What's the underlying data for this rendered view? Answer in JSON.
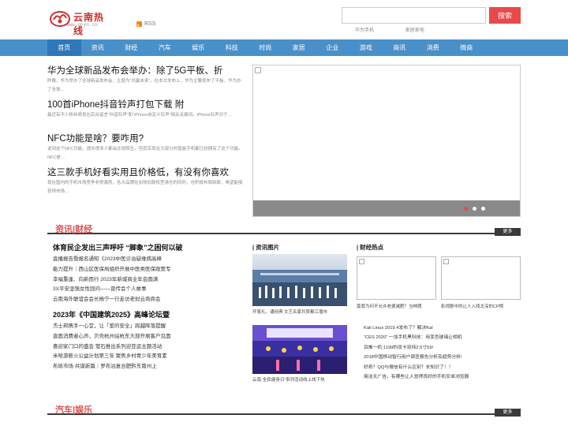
{
  "header": {
    "logo_name": "云南热线",
    "logo_url": "www.onyn.cn",
    "rss_label": "RSS",
    "search_placeholder": "",
    "search_button": "搜索",
    "hot_words": [
      "华为手机",
      "家居家电"
    ]
  },
  "nav": {
    "items": [
      "首页",
      "资讯",
      "财经",
      "汽车",
      "娱乐",
      "科技",
      "时尚",
      "家居",
      "企业",
      "游戏",
      "商讯",
      "消费",
      "微商"
    ],
    "active_index": 0
  },
  "headlines": [
    {
      "title": "华为全球新品发布会举办：除了5G平板、折",
      "desc": "昨晚，华为举办了全球新品发布会，主题为“共赢未来”。在本次发布上，华为主要发布了平板，华为办了全球…"
    },
    {
      "title": "100首iPhone抖音铃声打包下载 附",
      "desc": "最近有不少粉丝频发在后台留言“抖音铃声”和“iPhone自定义铃声”相关关键词。iPhone铃声对于…"
    },
    {
      "title": "NFC功能是啥？要咋用?",
      "desc": "说到这个NFC功能，提许很多人都会比较陌生，但其实现在大部分的智能手机都已经拥有了这个功能。NFC是…"
    },
    {
      "title": "这三款手机好看实用且价格低，有没有你喜欢",
      "desc": "现在国内的手机市场竞争非常激烈，各大品牌在加快旧款机型清仓的同时，也积极布局新款，希望能够获得市场…"
    }
  ],
  "carousel": {
    "active_dot": 0,
    "dot_count": 3
  },
  "section1": {
    "title": "资讯|财经",
    "more": "更多",
    "news_col": {
      "group1_title": "体育民企发出三声呼吁 “脚象”之困何以破",
      "group1_items": [
        "直播报告暨报名通知《2023中医诊治疑难病高峰",
        "能力提升｜西山区医保局组织开展中医类医保政策专",
        "幸福重逢、向新而行 2023年新城商业年会圆满",
        "3X平安坚强女性回问——曾传会个人故事",
        "云南海外联谊会会长杨宁一行走访老挝云商商会"
      ],
      "group2_title": "2023年《中国建筑2025》高峰论坛暨",
      "group2_items": [
        "杰士邦携手一心堂，让「爱的安全」跨越降落提醒",
        "直面消费者心声，贝壳杭州站杭东大部开展客户见面",
        "喜迎家门口的盛会 萤石推出系列迎亚运主题活动",
        "米哈游薪火公益计划第三年 聚焦乡村青少年美育素",
        "布局市场 共谋新篇｜罗布泊复合肥黔东南州上"
      ]
    },
    "images_col": {
      "head": "| 资讯图片",
      "items": [
        {
          "caption": "开笔礼、诵经典 文艺名家共贺都江堰市"
        },
        {
          "caption": "云南·全民健身日”系列活动线上线下热"
        }
      ]
    },
    "hot_col": {
      "head": "| 财经热点",
      "thumbs": [
        {
          "caption": "莫尊为何不允许老婆减肥？当林朗"
        },
        {
          "caption": "影视剧中的让人入戏太深的CP榜"
        }
      ],
      "list": [
        "Kali Linux 2019.4发布了？解决Kal",
        "“CES 2020” 一加手机黑科技：用变色玻璃让相机",
        "目推一机:1199的双卡双待2.5寸59!",
        "2018中国移动智行用户调查报告分析及趋势分析!",
        "好奇？QQ与微信有什么区别？长知识了！！",
        "简洁无广告，有哪些让人觉得良好的手机安卓浏览器"
      ]
    }
  },
  "section2": {
    "title": "汽车|娱乐",
    "more": "更多"
  },
  "colors": {
    "nav_bg": "#4a90c8",
    "nav_active": "#2f78b8",
    "accent_red": "#e84a4a",
    "section_title": "#e05050"
  }
}
